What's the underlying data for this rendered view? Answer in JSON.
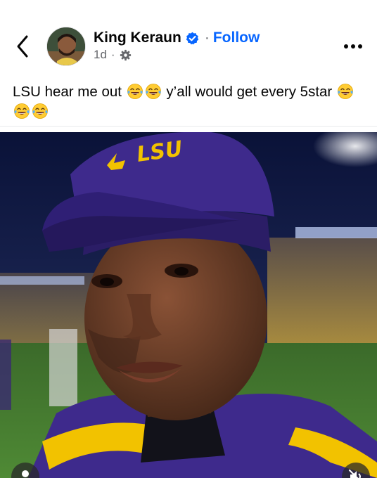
{
  "post": {
    "author": "King Keraun",
    "separator": "·",
    "follow_label": "Follow",
    "time": "1d",
    "meta_separator": "·",
    "text_line1_a": "LSU hear me out",
    "text_line1_b": "y’all would get every 5star",
    "emoji_name": "face-with-tears-of-joy"
  },
  "photo": {
    "cap_logo": "LSU"
  },
  "icons": {
    "back": "chevron-left-icon",
    "verified": "verified-badge-icon",
    "audience": "globe-gear-icon",
    "more": "more-dots-icon",
    "user_tag": "person-icon",
    "mute": "speaker-muted-icon"
  },
  "colors": {
    "follow": "#0866ff",
    "verified": "#0866ff",
    "secondary_text": "#65676b",
    "lsu_purple": "#3e2a8c",
    "lsu_gold": "#f2c200"
  }
}
